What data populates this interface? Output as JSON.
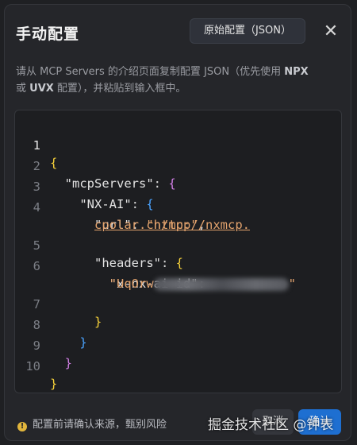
{
  "dialog": {
    "title": "手动配置",
    "json_button_label": "原始配置（JSON）",
    "close_icon": "close-icon",
    "description_part1": "请从 MCP Servers 的介绍页面复制配置 JSON（优先使用 ",
    "description_npx": "NPX",
    "description_part2": "或 ",
    "description_uvx": "UVX",
    "description_part3": " 配置），并粘贴到输入框中。"
  },
  "editor": {
    "line_numbers": [
      "1",
      "2",
      "3",
      "4",
      "5",
      "6",
      "7",
      "8",
      "9",
      "10"
    ],
    "key_mcpServers": "\"mcpServers\"",
    "key_server": "\"NX-AI\"",
    "key_url": "\"url\"",
    "url_value_line1": "http://nxmcp.",
    "url_value_line2": "cpolar.cn/mcp",
    "key_headers": "\"headers\"",
    "key_header_id": "\"x-nx-ai-id\"",
    "header_value_visible": "\"UqOrw",
    "header_value_tail": "\""
  },
  "footer": {
    "warning_text": "配置前请确认来源，甄别风险",
    "warning_icon": "info-icon",
    "cancel_label": "取消",
    "confirm_label": "确认"
  },
  "watermark": "掘金技术社区 @钟表"
}
